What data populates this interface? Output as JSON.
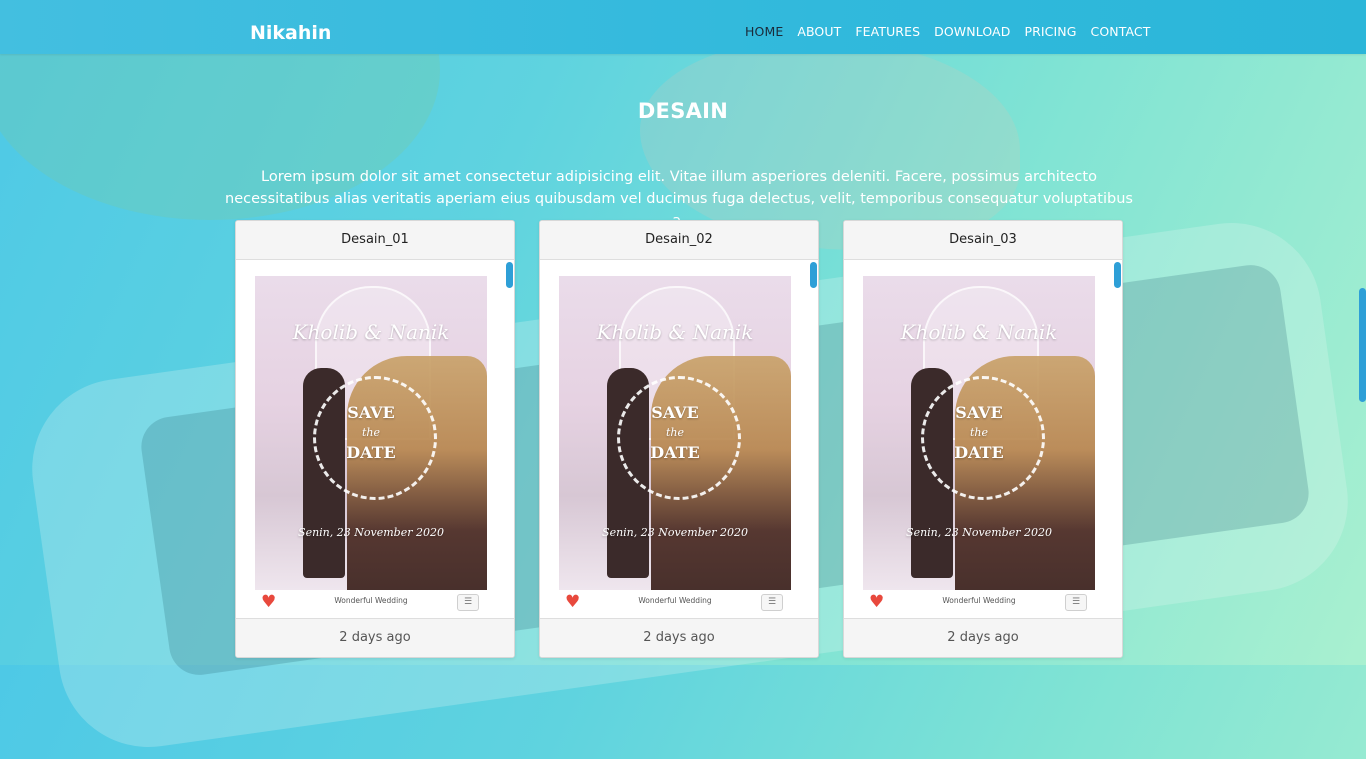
{
  "brand": "Nikahin",
  "nav": {
    "items": [
      "HOME",
      "ABOUT",
      "FEATURES",
      "DOWNLOAD",
      "PRICING",
      "CONTACT"
    ]
  },
  "section": {
    "title": "DESAIN",
    "lead_line1": "Lorem ipsum dolor sit amet consectetur adipisicing elit. Vitae illum asperiores deleniti. Facere, possimus architecto",
    "lead_line2": "necessitatibus alias veritatis aperiam eius quibusdam vel ducimus fuga delectus, velit, temporibus consequatur voluptatibus a."
  },
  "cards": [
    {
      "title": "Desain_01",
      "footer": "2 days ago",
      "preview": {
        "names": "Kholib & Nanik",
        "save": "SAVE",
        "the": "the",
        "date_word": "DATE",
        "date": "Senin, 23 November 2020",
        "label": "Wonderful Wedding"
      }
    },
    {
      "title": "Desain_02",
      "footer": "2 days ago",
      "preview": {
        "names": "Kholib & Nanik",
        "save": "SAVE",
        "the": "the",
        "date_word": "DATE",
        "date": "Senin, 23 November 2020",
        "label": "Wonderful Wedding"
      }
    },
    {
      "title": "Desain_03",
      "footer": "2 days ago",
      "preview": {
        "names": "Kholib & Nanik",
        "save": "SAVE",
        "the": "the",
        "date_word": "DATE",
        "date": "Senin, 23 November 2020",
        "label": "Wonderful Wedding"
      }
    }
  ],
  "colors": {
    "accent": "#2e9fd7",
    "heart": "#e8493d",
    "nav_active": "#1b2b3a"
  },
  "icons": {
    "heart": "heart-icon",
    "menu": "menu-icon"
  }
}
